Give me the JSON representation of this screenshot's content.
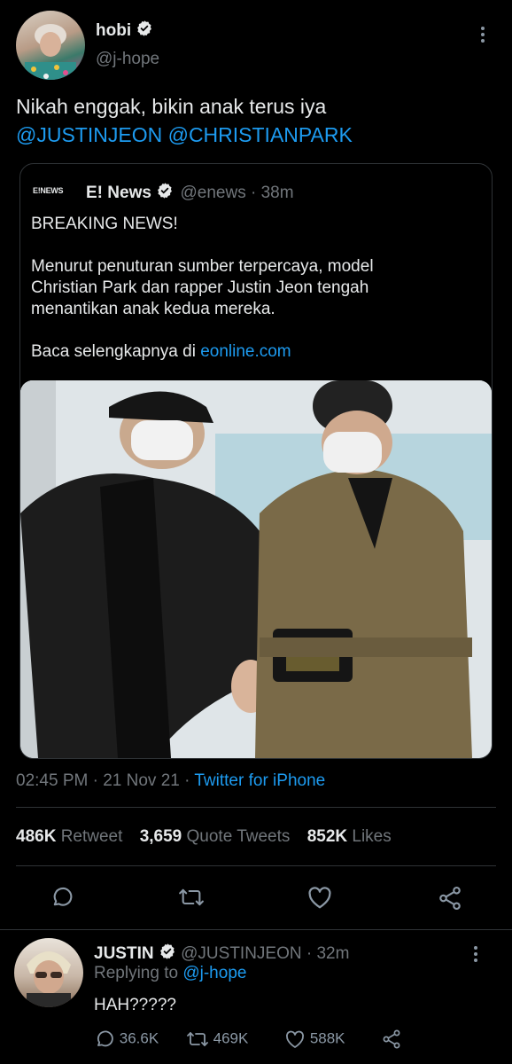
{
  "tweet": {
    "display_name": "hobi",
    "handle": "@j-hope",
    "text_line1": "Nikah enggak, bikin anak terus iya",
    "mention1": "@JUSTINJEON",
    "mention2": "@CHRISTIANPARK",
    "timestamp": "02:45 PM · 21 Nov 21 · ",
    "source": "Twitter for iPhone",
    "retweets_count": "486K",
    "retweets_label": "Retweet",
    "quotes_count": "3,659",
    "quotes_label": "Quote Tweets",
    "likes_count": "852K",
    "likes_label": "Likes"
  },
  "quoted": {
    "logo_text": "E!NEWS",
    "display_name": "E! News",
    "meta": "@enews · 38m",
    "line_breaking": "BREAKING NEWS!",
    "para1": "Menurut penuturan sumber terpercaya, model Christian Park dan rapper Justin Jeon tengah menantikan anak kedua mereka.",
    "read_more_prefix": "Baca selengkapnya di ",
    "read_more_link": "eonline.com"
  },
  "reply": {
    "display_name": "JUSTIN",
    "meta": "@JUSTINJEON · 32m",
    "replying_prefix": "Replying to ",
    "replying_handle": "@j-hope",
    "text": "HAH?????",
    "replies": "36.6K",
    "retweets": "469K",
    "likes": "588K"
  },
  "colors": {
    "accent": "#1d9bf0",
    "background": "#000000",
    "muted": "#71767b"
  },
  "icons": [
    "verified-icon",
    "more-icon",
    "reply-icon",
    "retweet-icon",
    "like-icon",
    "share-icon"
  ]
}
